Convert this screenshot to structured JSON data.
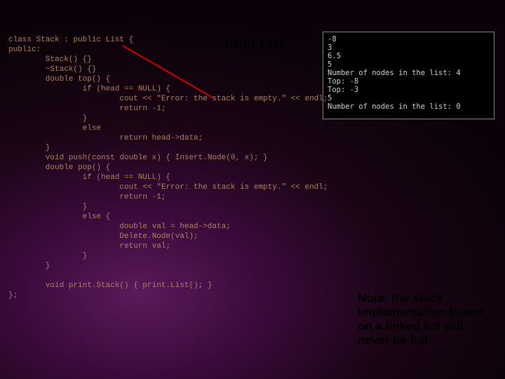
{
  "callout": "from List",
  "code": "class Stack : public List {\npublic:\n        Stack() {}\n        ~Stack() {}\n        double top() {\n                if (head == NULL) {\n                        cout << \"Error: the stack is empty.\" << endl;\n                        return -1;\n                }\n                else\n                        return head->data;\n        }\n        void push(const double x) { Insert.Node(0, x); }\n        double pop() {\n                if (head == NULL) {\n                        cout << \"Error: the stack is empty.\" << endl;\n                        return -1;\n                }\n                else {\n                        double val = head->data;\n                        Delete.Node(val);\n                        return val;\n                }\n        }\n\n        void print.Stack() { print.List(); }\n};",
  "console": "-8\n3\n6.5\n5\nNumber of nodes in the list: 4\nTop: -8\nTop: -3\n5\nNumber of nodes in the list: 0",
  "note": "Note: the stack implementation based on a linked list will never be full."
}
